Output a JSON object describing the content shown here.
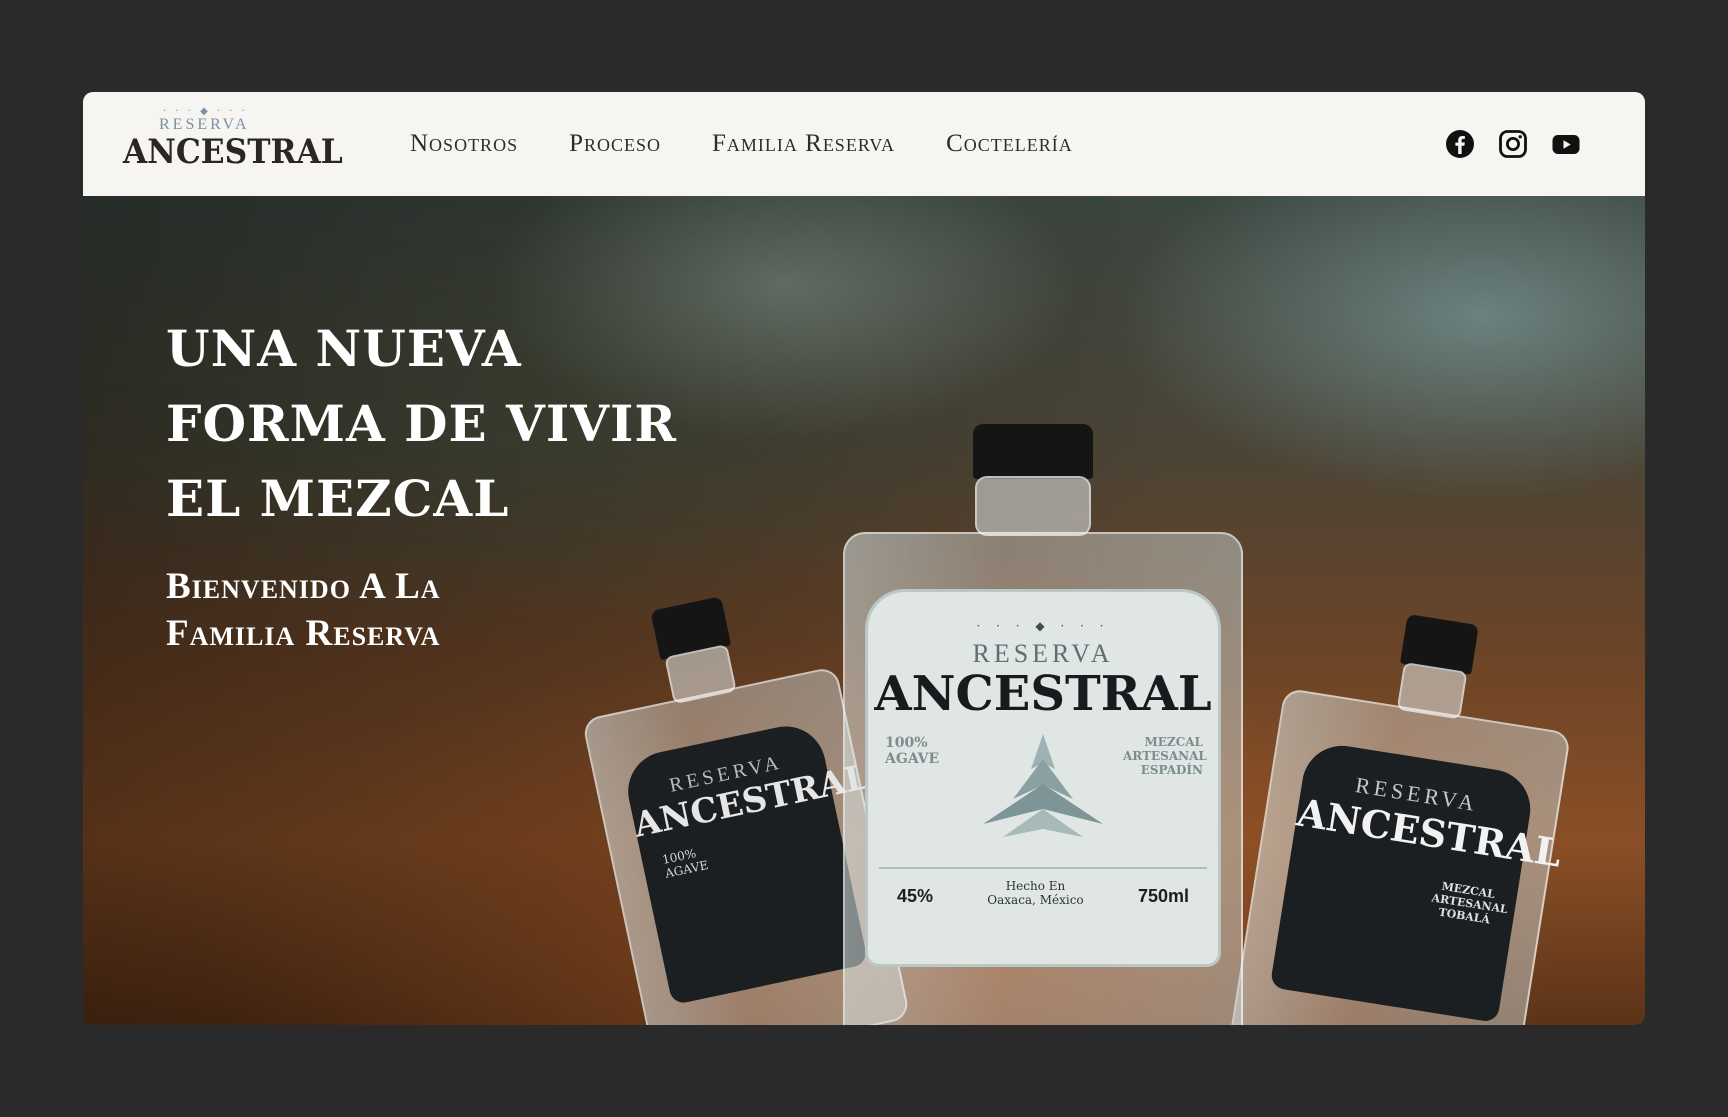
{
  "brand": {
    "logo_small": "RESERVA",
    "logo_big": "ANCESTRAL"
  },
  "nav": {
    "items": [
      "Nosotros",
      "Proceso",
      "Familia Reserva",
      "Coctelería"
    ]
  },
  "social": {
    "icons": [
      "facebook-icon",
      "instagram-icon",
      "youtube-icon"
    ]
  },
  "hero": {
    "title_lines": [
      "UNA NUEVA",
      "FORMA DE VIVIR",
      "EL MEZCAL"
    ],
    "subtitle_lines": [
      "Bienvenido A La",
      "Familia Reserva"
    ]
  },
  "bottle_labels": {
    "center": {
      "small": "RESERVA",
      "big": "ANCESTRAL",
      "agave": "100% AGAVE",
      "type": "MEZCAL ARTESANAL ESPADÍN",
      "abv": "45%",
      "origin": "Hecho En Oaxaca, México",
      "volume": "750ml"
    },
    "left": {
      "small": "RESERVA",
      "big": "ANCESTRAL",
      "agave": "100% AGAVE"
    },
    "right": {
      "small": "RESERVA",
      "big": "ANCESTRAL",
      "type": "MEZCAL ARTESANAL TOBALÁ"
    }
  },
  "colors": {
    "page_bg": "#2a2a2a",
    "header_bg": "#f6f5f1",
    "nav_text": "#2c2c2c",
    "hero_text": "#ffffff"
  }
}
